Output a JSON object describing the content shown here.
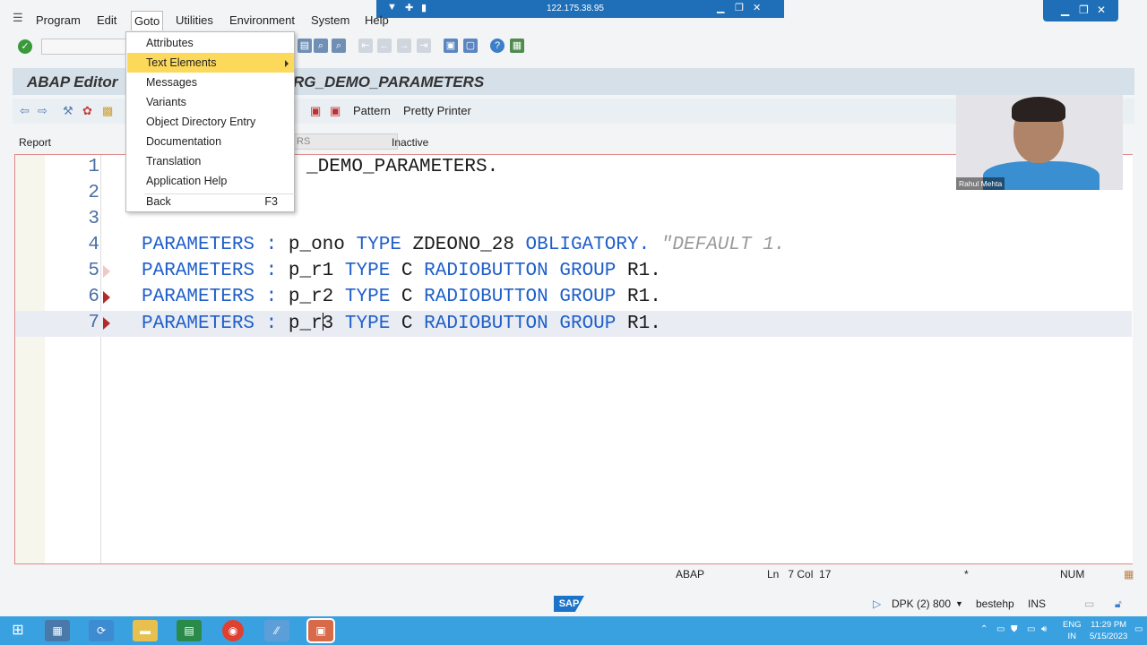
{
  "remote": {
    "ip": "122.175.38.95"
  },
  "menubar": [
    "Program",
    "Edit",
    "Goto",
    "Utilities",
    "Environment",
    "System",
    "Help"
  ],
  "title": {
    "left": "ABAP Editor",
    "right": "RG_DEMO_PARAMETERS"
  },
  "app_toolbar": {
    "pattern": "Pattern",
    "pretty_printer": "Pretty Printer"
  },
  "info": {
    "report_label": "Report",
    "program_field": "RS",
    "status": "Inactive"
  },
  "goto_menu": {
    "items": [
      "Attributes",
      "Text Elements",
      "Messages",
      "Variants",
      "Object Directory Entry",
      "Documentation",
      "Translation",
      "Application Help",
      "Back"
    ],
    "back_shortcut": "F3"
  },
  "editor": {
    "line_numbers": [
      "1",
      "2",
      "3",
      "4",
      "5",
      "6",
      "7"
    ],
    "line1": "_DEMO_PARAMETERS.",
    "line4": {
      "kw1": "PARAMETERS",
      "colon": ":",
      "var": "p_ono",
      "kw2": "TYPE",
      "type": "ZDEONO_28",
      "kw3": "OBLIGATORY.",
      "comment": "\"DEFAULT 1."
    },
    "line5": {
      "kw1": "PARAMETERS",
      "colon": ":",
      "var": "p_r1",
      "kw2": "TYPE",
      "type": "C",
      "kw3": "RADIOBUTTON",
      "kw4": "GROUP",
      "grp": "R1."
    },
    "line6": {
      "kw1": "PARAMETERS",
      "colon": ":",
      "var": "p_r2",
      "kw2": "TYPE",
      "type": "C",
      "kw3": "RADIOBUTTON",
      "kw4": "GROUP",
      "grp": "R1."
    },
    "line7": {
      "kw1": "PARAMETERS",
      "colon": ":",
      "var_a": "p_r",
      "var_b": "3",
      "kw2": "TYPE",
      "type": "C",
      "kw3": "RADIOBUTTON",
      "kw4": "GROUP",
      "grp": "R1."
    }
  },
  "webcam": {
    "name": "Rahul Mehta"
  },
  "status_line": {
    "lang": "ABAP",
    "position": "Ln   7 Col  17",
    "marker": "*",
    "num": "NUM"
  },
  "footer": {
    "system": "DPK (2) 800",
    "user": "bestehp",
    "mode": "INS",
    "logo": "SAP"
  },
  "taskbar": {
    "lang_top": "ENG",
    "lang_bottom": "IN",
    "time": "11:29 PM",
    "date": "5/15/2023"
  }
}
